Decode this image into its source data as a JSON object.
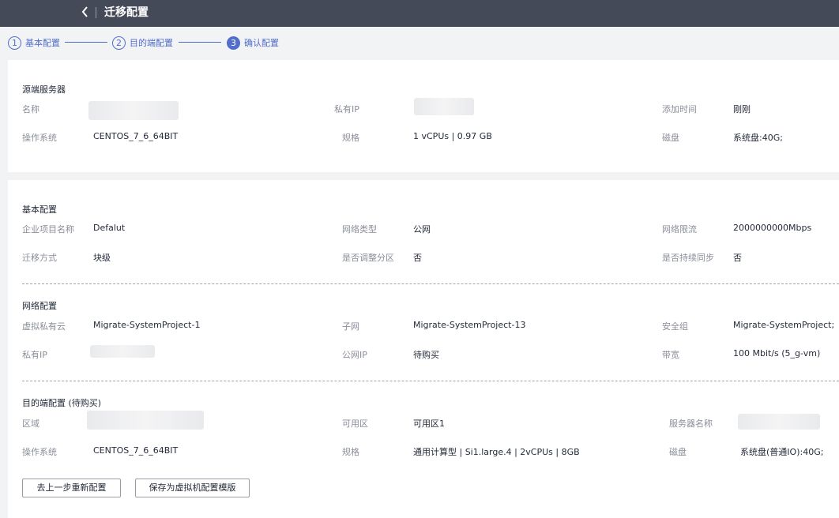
{
  "header": {
    "back_icon": "chevron-left-icon",
    "title": "迁移配置"
  },
  "steps": [
    {
      "num": "1",
      "label": "基本配置"
    },
    {
      "num": "2",
      "label": "目的端配置"
    },
    {
      "num": "3",
      "label": "确认配置"
    }
  ],
  "source": {
    "title": "源端服务器",
    "name_label": "名称",
    "private_ip_label": "私有IP",
    "added_time_label": "添加时间",
    "added_time_value": "刚刚",
    "os_label": "操作系统",
    "os_value": "CENTOS_7_6_64BIT",
    "spec_label": "规格",
    "spec_value": "1 vCPUs | 0.97 GB",
    "disk_label": "磁盘",
    "disk_value": "系统盘:40G;"
  },
  "basic": {
    "title": "基本配置",
    "project_label": "企业项目名称",
    "project_value": "Defalut",
    "network_type_label": "网络类型",
    "network_type_value": "公网",
    "limit_label": "网络限流",
    "limit_value": "2000000000Mbps",
    "method_label": "迁移方式",
    "method_value": "块级",
    "partition_label": "是否调整分区",
    "partition_value": "否",
    "sync_label": "是否持续同步",
    "sync_value": "否"
  },
  "network": {
    "title": "网络配置",
    "vpc_label": "虚拟私有云",
    "vpc_value": "Migrate-SystemProject-1",
    "subnet_label": "子网",
    "subnet_value": "Migrate-SystemProject-13",
    "sg_label": "安全组",
    "sg_value": "Migrate-SystemProject;",
    "private_ip_label": "私有IP",
    "public_ip_label": "公网IP",
    "public_ip_value": "待购买",
    "bandwidth_label": "带宽",
    "bandwidth_value": "100 Mbit/s (5_g-vm)"
  },
  "target": {
    "title": "目的端配置 (待购买)",
    "region_label": "区域",
    "az_label": "可用区",
    "az_value": "可用区1",
    "server_name_label": "服务器名称",
    "os_label": "操作系统",
    "os_value": "CENTOS_7_6_64BIT",
    "spec_label": "规格",
    "spec_value": "通用计算型 | Si1.large.4 | 2vCPUs | 8GB",
    "disk_label": "磁盘",
    "disk_value": "系统盘(普通IO):40G;"
  },
  "actions": {
    "prev_label": "去上一步重新配置",
    "save_template_label": "保存为虚拟机配置模版"
  }
}
